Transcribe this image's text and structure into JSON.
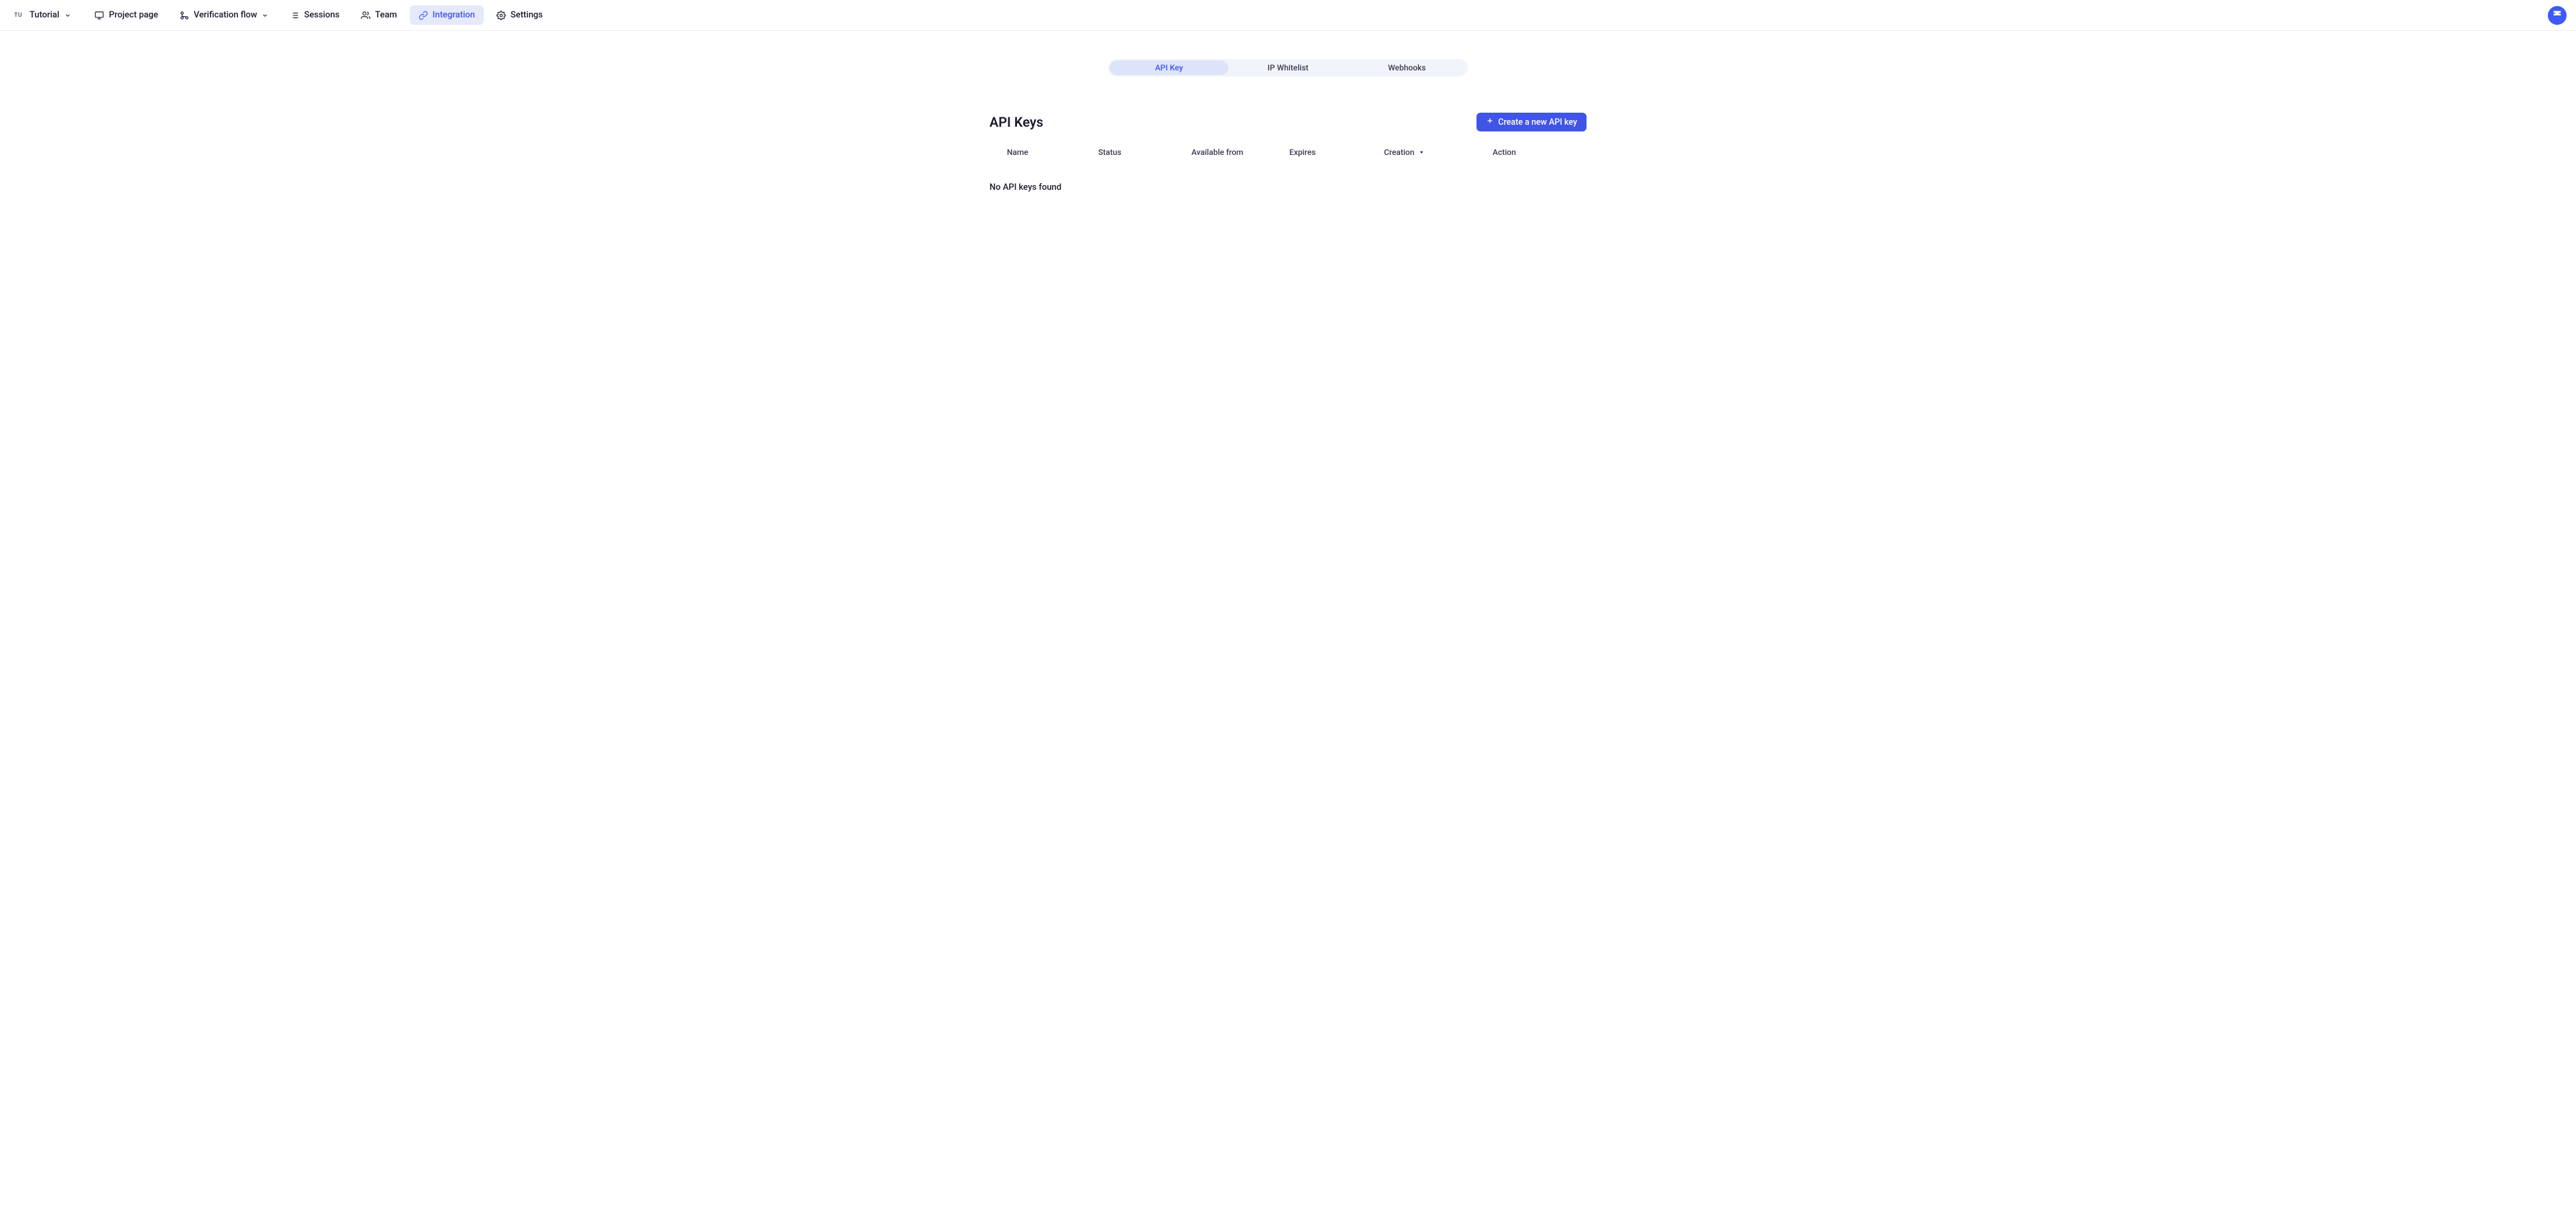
{
  "project": {
    "badge": "TU",
    "name": "Tutorial"
  },
  "nav": {
    "items": [
      {
        "label": "Project page"
      },
      {
        "label": "Verification flow"
      },
      {
        "label": "Sessions"
      },
      {
        "label": "Team"
      },
      {
        "label": "Integration"
      },
      {
        "label": "Settings"
      }
    ]
  },
  "tabs": {
    "items": [
      {
        "label": "API Key"
      },
      {
        "label": "IP Whitelist"
      },
      {
        "label": "Webhooks"
      }
    ]
  },
  "page": {
    "title": "API Keys",
    "create_button": "Create a new API key",
    "empty": "No API keys found"
  },
  "table": {
    "columns": {
      "name": "Name",
      "status": "Status",
      "available_from": "Available from",
      "expires": "Expires",
      "creation": "Creation",
      "action": "Action"
    }
  },
  "colors": {
    "primary": "#4054e8",
    "nav_active_bg": "#e4e9fb",
    "segment_bg": "#f2f4fb",
    "segment_active_bg": "#dde4fa"
  }
}
